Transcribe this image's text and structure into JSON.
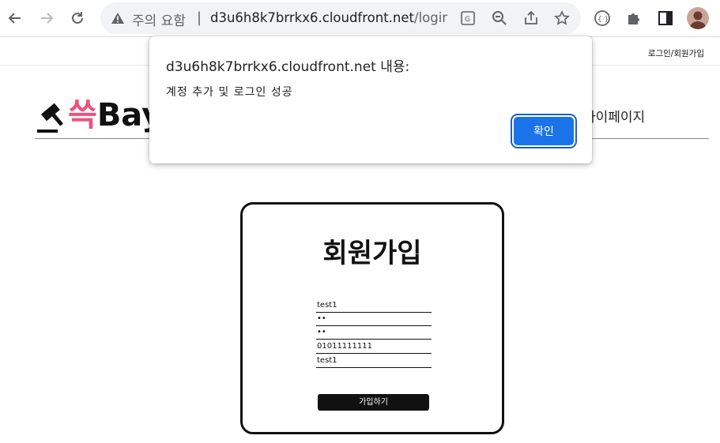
{
  "browser": {
    "security_label": "주의 요함",
    "separator": "|",
    "url_host": "d3u6h8k7brrkx6.cloudfront.net",
    "url_path": "/login...",
    "icons": [
      "back-icon",
      "forward-icon",
      "reload-icon",
      "warning-icon",
      "translate-icon",
      "zoom-out-icon",
      "share-icon",
      "star-icon",
      "extension-cs-icon",
      "puzzle-icon",
      "sidepanel-icon",
      "profile-avatar"
    ]
  },
  "page": {
    "login_link": "로그인/회원가입",
    "logo_kor": "쓱",
    "logo_en": "Bay",
    "nav_mypage": "마이페이지",
    "accent_color": "#f0507c"
  },
  "signup": {
    "title": "회원가입",
    "fields": [
      "test1",
      "••",
      "••",
      "01011111111",
      "test1"
    ],
    "submit_label": "가입하기"
  },
  "alert": {
    "title": "d3u6h8k7brrkx6.cloudfront.net 내용:",
    "message": "계정 추가 및 로그인 성공",
    "ok_label": "확인",
    "ok_color": "#1a73e8"
  }
}
